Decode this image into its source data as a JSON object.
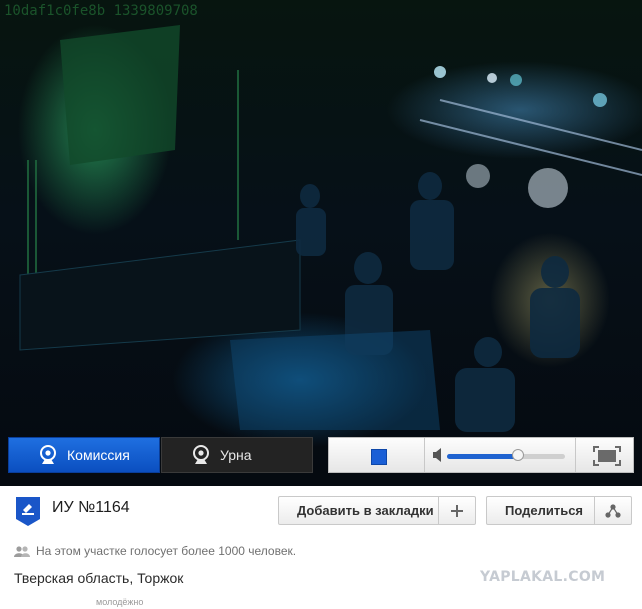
{
  "video": {
    "overlay_text": "10daf1c0fe8b 1339809708"
  },
  "tabs": [
    {
      "label": "Комиссия",
      "active": true,
      "icon": "webcam-icon"
    },
    {
      "label": "Урна",
      "active": false,
      "icon": "webcam-icon"
    }
  ],
  "player": {
    "volume": 0.6,
    "controls": [
      "stop-icon",
      "volume-icon",
      "fullscreen-icon"
    ]
  },
  "station": {
    "title": "ИУ №1164",
    "badge_icon": "ballot-check-icon",
    "note": "На этом участке голосует более 1000 человек.",
    "note_icon": "people-icon",
    "region": "Тверская область, Торжок"
  },
  "actions": {
    "bookmark_label": "Добавить в закладки",
    "bookmark_icon": "plus-icon",
    "share_label": "Поделиться",
    "share_icon": "share-icon"
  },
  "watermark": "YAPLAKAL.COM",
  "footer_fragment": "молодёжно",
  "colors": {
    "accent_blue": "#1f63d0",
    "dark_tab": "#232323"
  }
}
